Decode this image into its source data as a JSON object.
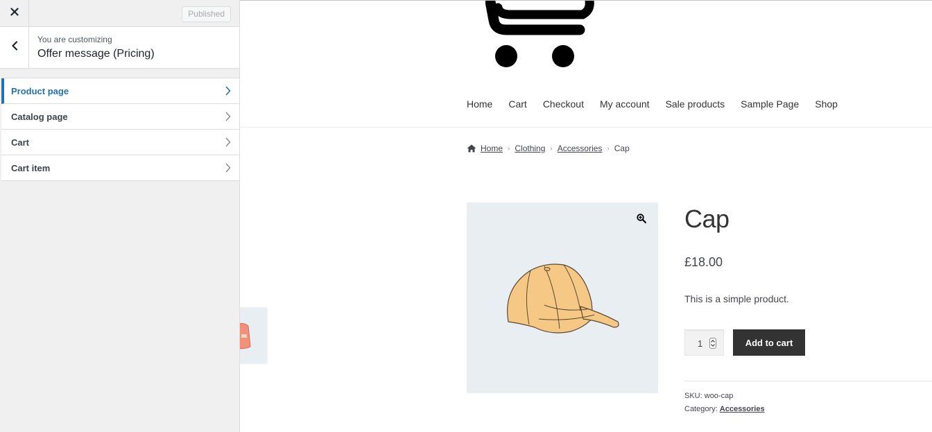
{
  "customizer": {
    "close_icon": "close-icon",
    "publish_button": "Published",
    "customizing_label": "You are customizing",
    "customizing_title": "Offer message (Pricing)",
    "back_icon": "chevron-left-icon",
    "sections": [
      {
        "label": "Product page",
        "active": true
      },
      {
        "label": "Catalog page",
        "active": false
      },
      {
        "label": "Cart",
        "active": false
      },
      {
        "label": "Cart item",
        "active": false
      }
    ],
    "accent_color": "#2271b1"
  },
  "site": {
    "logo_icon": "shopping-cart-icon",
    "nav": [
      "Home",
      "Cart",
      "Checkout",
      "My account",
      "Sale products",
      "Sample Page",
      "Shop"
    ],
    "breadcrumb": {
      "home": "Home",
      "items": [
        "Clothing",
        "Accessories"
      ],
      "current": "Cap"
    }
  },
  "product": {
    "title": "Cap",
    "price": "£18.00",
    "description": "This is a simple product.",
    "quantity": "1",
    "add_to_cart": "Add to cart",
    "sku_label": "SKU:",
    "sku": "woo-cap",
    "category_label": "Category:",
    "category": "Accessories",
    "zoom_icon": "zoom-in-icon",
    "image_icon": "cap-image"
  }
}
